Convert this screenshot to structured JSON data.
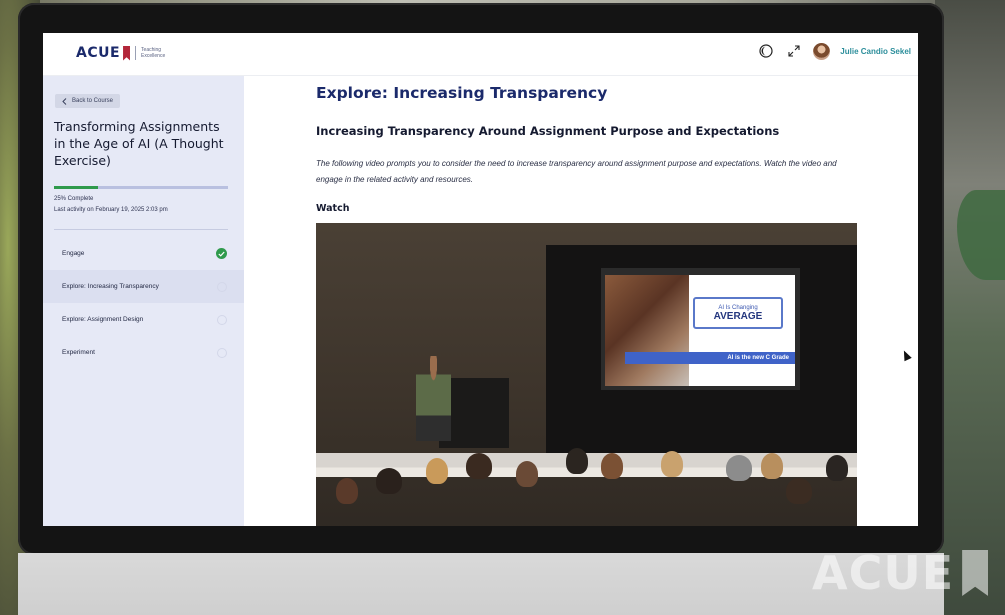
{
  "header": {
    "logo_text": "ACUE",
    "logo_tagline": "Teaching Excellence",
    "user_name": "Julie Candio Sekel"
  },
  "sidebar": {
    "back_label": "Back to Course",
    "course_title": "Transforming Assignments in the Age of AI (A Thought Exercise)",
    "progress": {
      "percent": 25,
      "label": "25% Complete"
    },
    "last_activity": "Last activity on February 19, 2025 2:03 pm",
    "modules": [
      {
        "label": "Engage",
        "status": "complete"
      },
      {
        "label": "Explore: Increasing Transparency",
        "status": "current"
      },
      {
        "label": "Explore: Assignment Design",
        "status": "incomplete"
      },
      {
        "label": "Experiment",
        "status": "incomplete"
      }
    ]
  },
  "main": {
    "heading": "Explore: Increasing Transparency",
    "subheading": "Increasing Transparency Around Assignment Purpose and Expectations",
    "intro": "The following video prompts you to consider the need to increase transparency around assignment purpose and expectations. Watch the video and engage in the related activity and resources.",
    "watch_label": "Watch",
    "video": {
      "slide_badge_top": "AI Is Changing",
      "slide_badge_main": "AVERAGE",
      "slide_arrow_text": "AI is the new C Grade"
    }
  },
  "watermark": {
    "text": "ACUE"
  },
  "colors": {
    "brand_navy": "#1b2a6b",
    "brand_red": "#b3263a",
    "success_green": "#2f9a4c",
    "accent_teal": "#2c8e9b",
    "sidebar_bg": "#e6e9f6"
  }
}
